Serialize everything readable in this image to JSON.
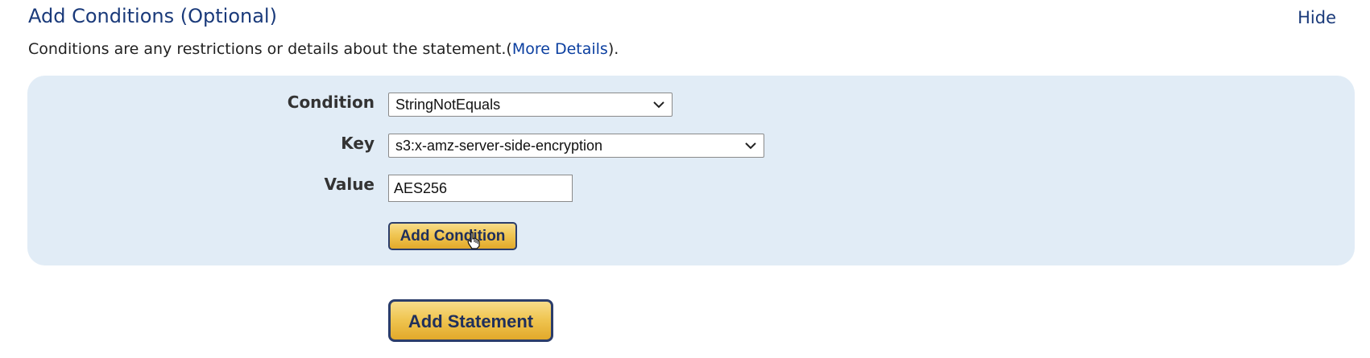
{
  "section": {
    "title": "Add Conditions (Optional)",
    "hide_label": "Hide",
    "description_text": "Conditions are any restrictions or details about the statement.(",
    "more_details_label": "More Details",
    "description_suffix": ")."
  },
  "form": {
    "condition": {
      "label": "Condition",
      "value": "StringNotEquals"
    },
    "key": {
      "label": "Key",
      "value": "s3:x-amz-server-side-encryption"
    },
    "value": {
      "label": "Value",
      "value": "AES256"
    },
    "add_condition_label": "Add Condition"
  },
  "add_statement_label": "Add Statement",
  "icons": {
    "dropdown": "chevron-down-icon",
    "cursor": "hand-pointer-icon"
  },
  "colors": {
    "title": "#1a3a7a",
    "link": "#0b3fa0",
    "panel_bg": "#e1ecf6",
    "button_gold": "#f0c653",
    "button_border": "#2b3d6b"
  }
}
